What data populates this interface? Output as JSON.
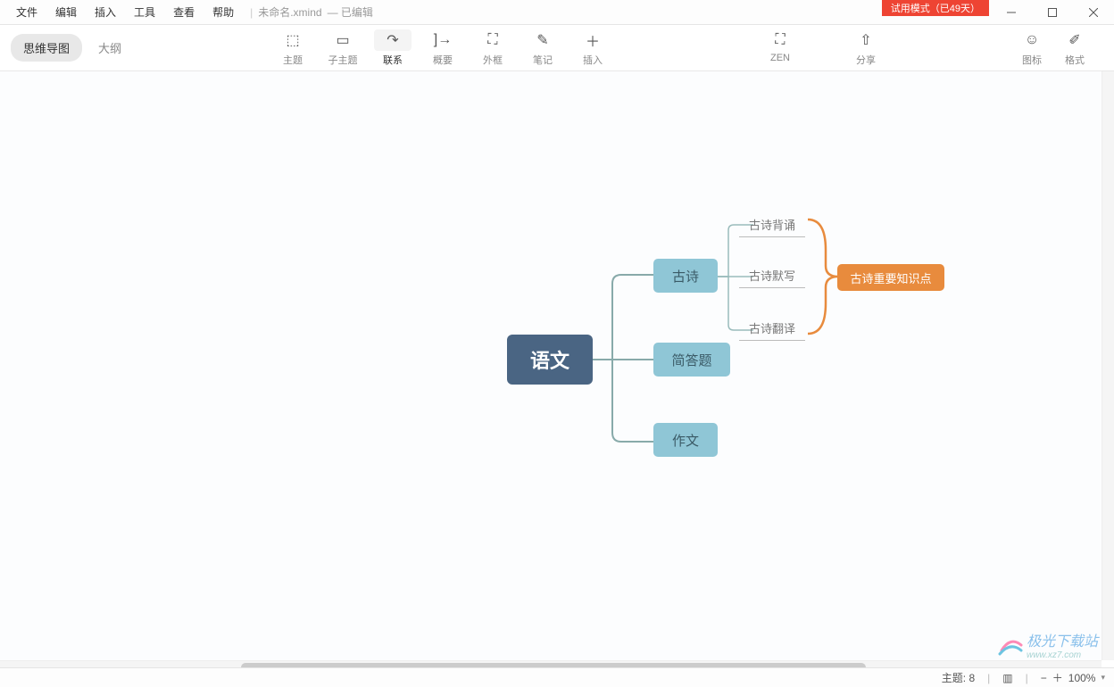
{
  "menu": [
    "文件",
    "编辑",
    "插入",
    "工具",
    "查看",
    "帮助"
  ],
  "file": {
    "name": "未命名.xmind",
    "status": "已编辑"
  },
  "trial": "试用模式（已49天）",
  "viewTabs": {
    "mindmap": "思维导图",
    "outline": "大纲"
  },
  "tools": {
    "topic": "主题",
    "subtopic": "子主题",
    "relation": "联系",
    "summary": "概要",
    "boundary": "外框",
    "note": "笔记",
    "insert": "插入",
    "zen": "ZEN",
    "share": "分享",
    "iconPanel": "图标",
    "formatPanel": "格式"
  },
  "mindmap": {
    "root": "语文",
    "branches": [
      "古诗",
      "简答题",
      "作文"
    ],
    "leaves": [
      "古诗背诵",
      "古诗默写",
      "古诗翻译"
    ],
    "summary": "古诗重要知识点"
  },
  "status": {
    "topicLabel": "主题:",
    "topicCount": "8",
    "zoom": "100%"
  },
  "watermark": {
    "main": "极光下载站",
    "sub": "www.xz7.com"
  }
}
